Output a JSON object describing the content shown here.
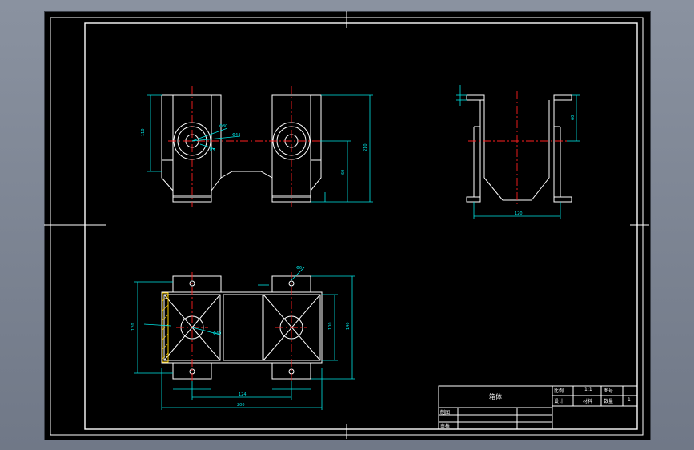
{
  "colors": {
    "background": "#000000",
    "outline": "#ffffff",
    "dimension": "#00e5e5",
    "centerline": "#ff2020",
    "hatch": "#ffd000"
  },
  "title_block": {
    "part_name": "箱体",
    "scale_label": "比例",
    "scale_value": "1:1",
    "drawing_no_label": "图号",
    "designer_label": "设计",
    "material_label": "材料",
    "quantity_label": "数量",
    "quantity_value": "1",
    "drafter_label": "制图",
    "checker_label": "审核"
  }
}
